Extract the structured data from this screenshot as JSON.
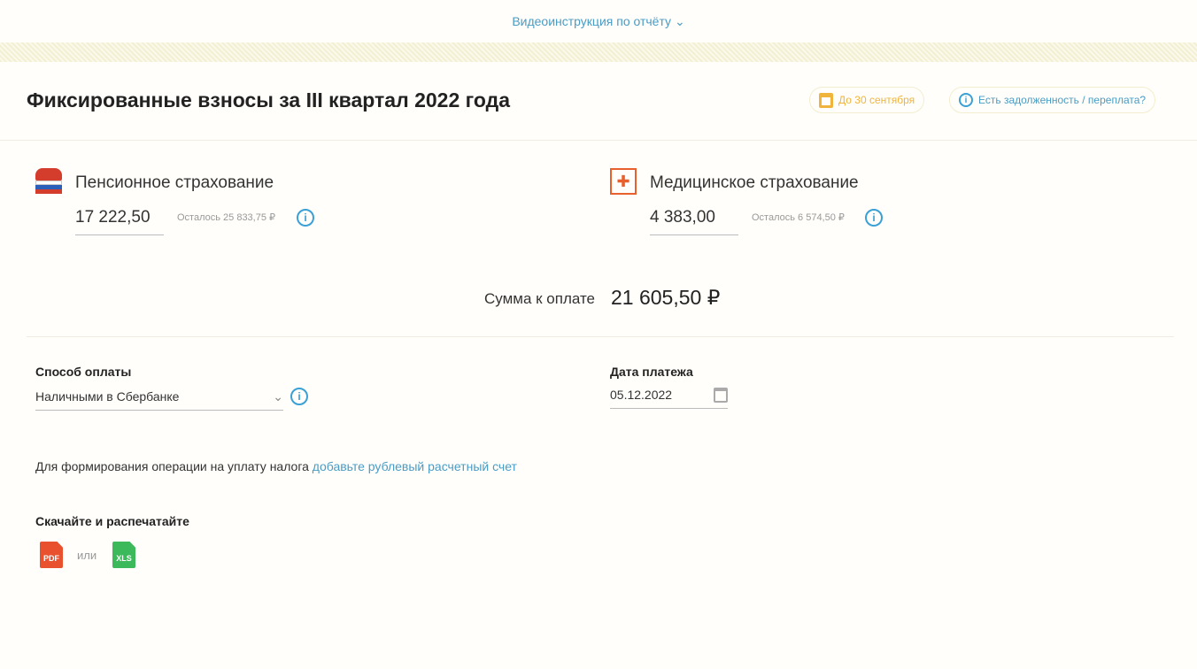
{
  "top_link": "Видеоинструкция по отчёту",
  "title": "Фиксированные взносы за III квартал 2022 года",
  "deadline": "До 30 сентября",
  "debt_link": "Есть задолженность / переплата?",
  "pension": {
    "title": "Пенсионное страхование",
    "amount": "17 222,50",
    "rest": "Осталось 25 833,75 ₽"
  },
  "medical": {
    "title": "Медицинское страхование",
    "amount": "4 383,00",
    "rest": "Осталось 6 574,50 ₽"
  },
  "total": {
    "label": "Сумма к оплате",
    "value": "21 605,50 ₽"
  },
  "payment_method": {
    "label": "Способ оплаты",
    "value": "Наличными в Сбербанке"
  },
  "payment_date": {
    "label": "Дата платежа",
    "value": "05.12.2022"
  },
  "notice": {
    "text": "Для формирования операции на уплату налога ",
    "link": "добавьте рублевый расчетный счет"
  },
  "download": {
    "label": "Скачайте и распечатайте",
    "pdf": "PDF",
    "or": "или",
    "xls": "XLS"
  },
  "colors": {
    "accent": "#4a9cc4",
    "deadline": "#f0b43c",
    "pdf": "#e8502e",
    "xls": "#3cb95a"
  }
}
